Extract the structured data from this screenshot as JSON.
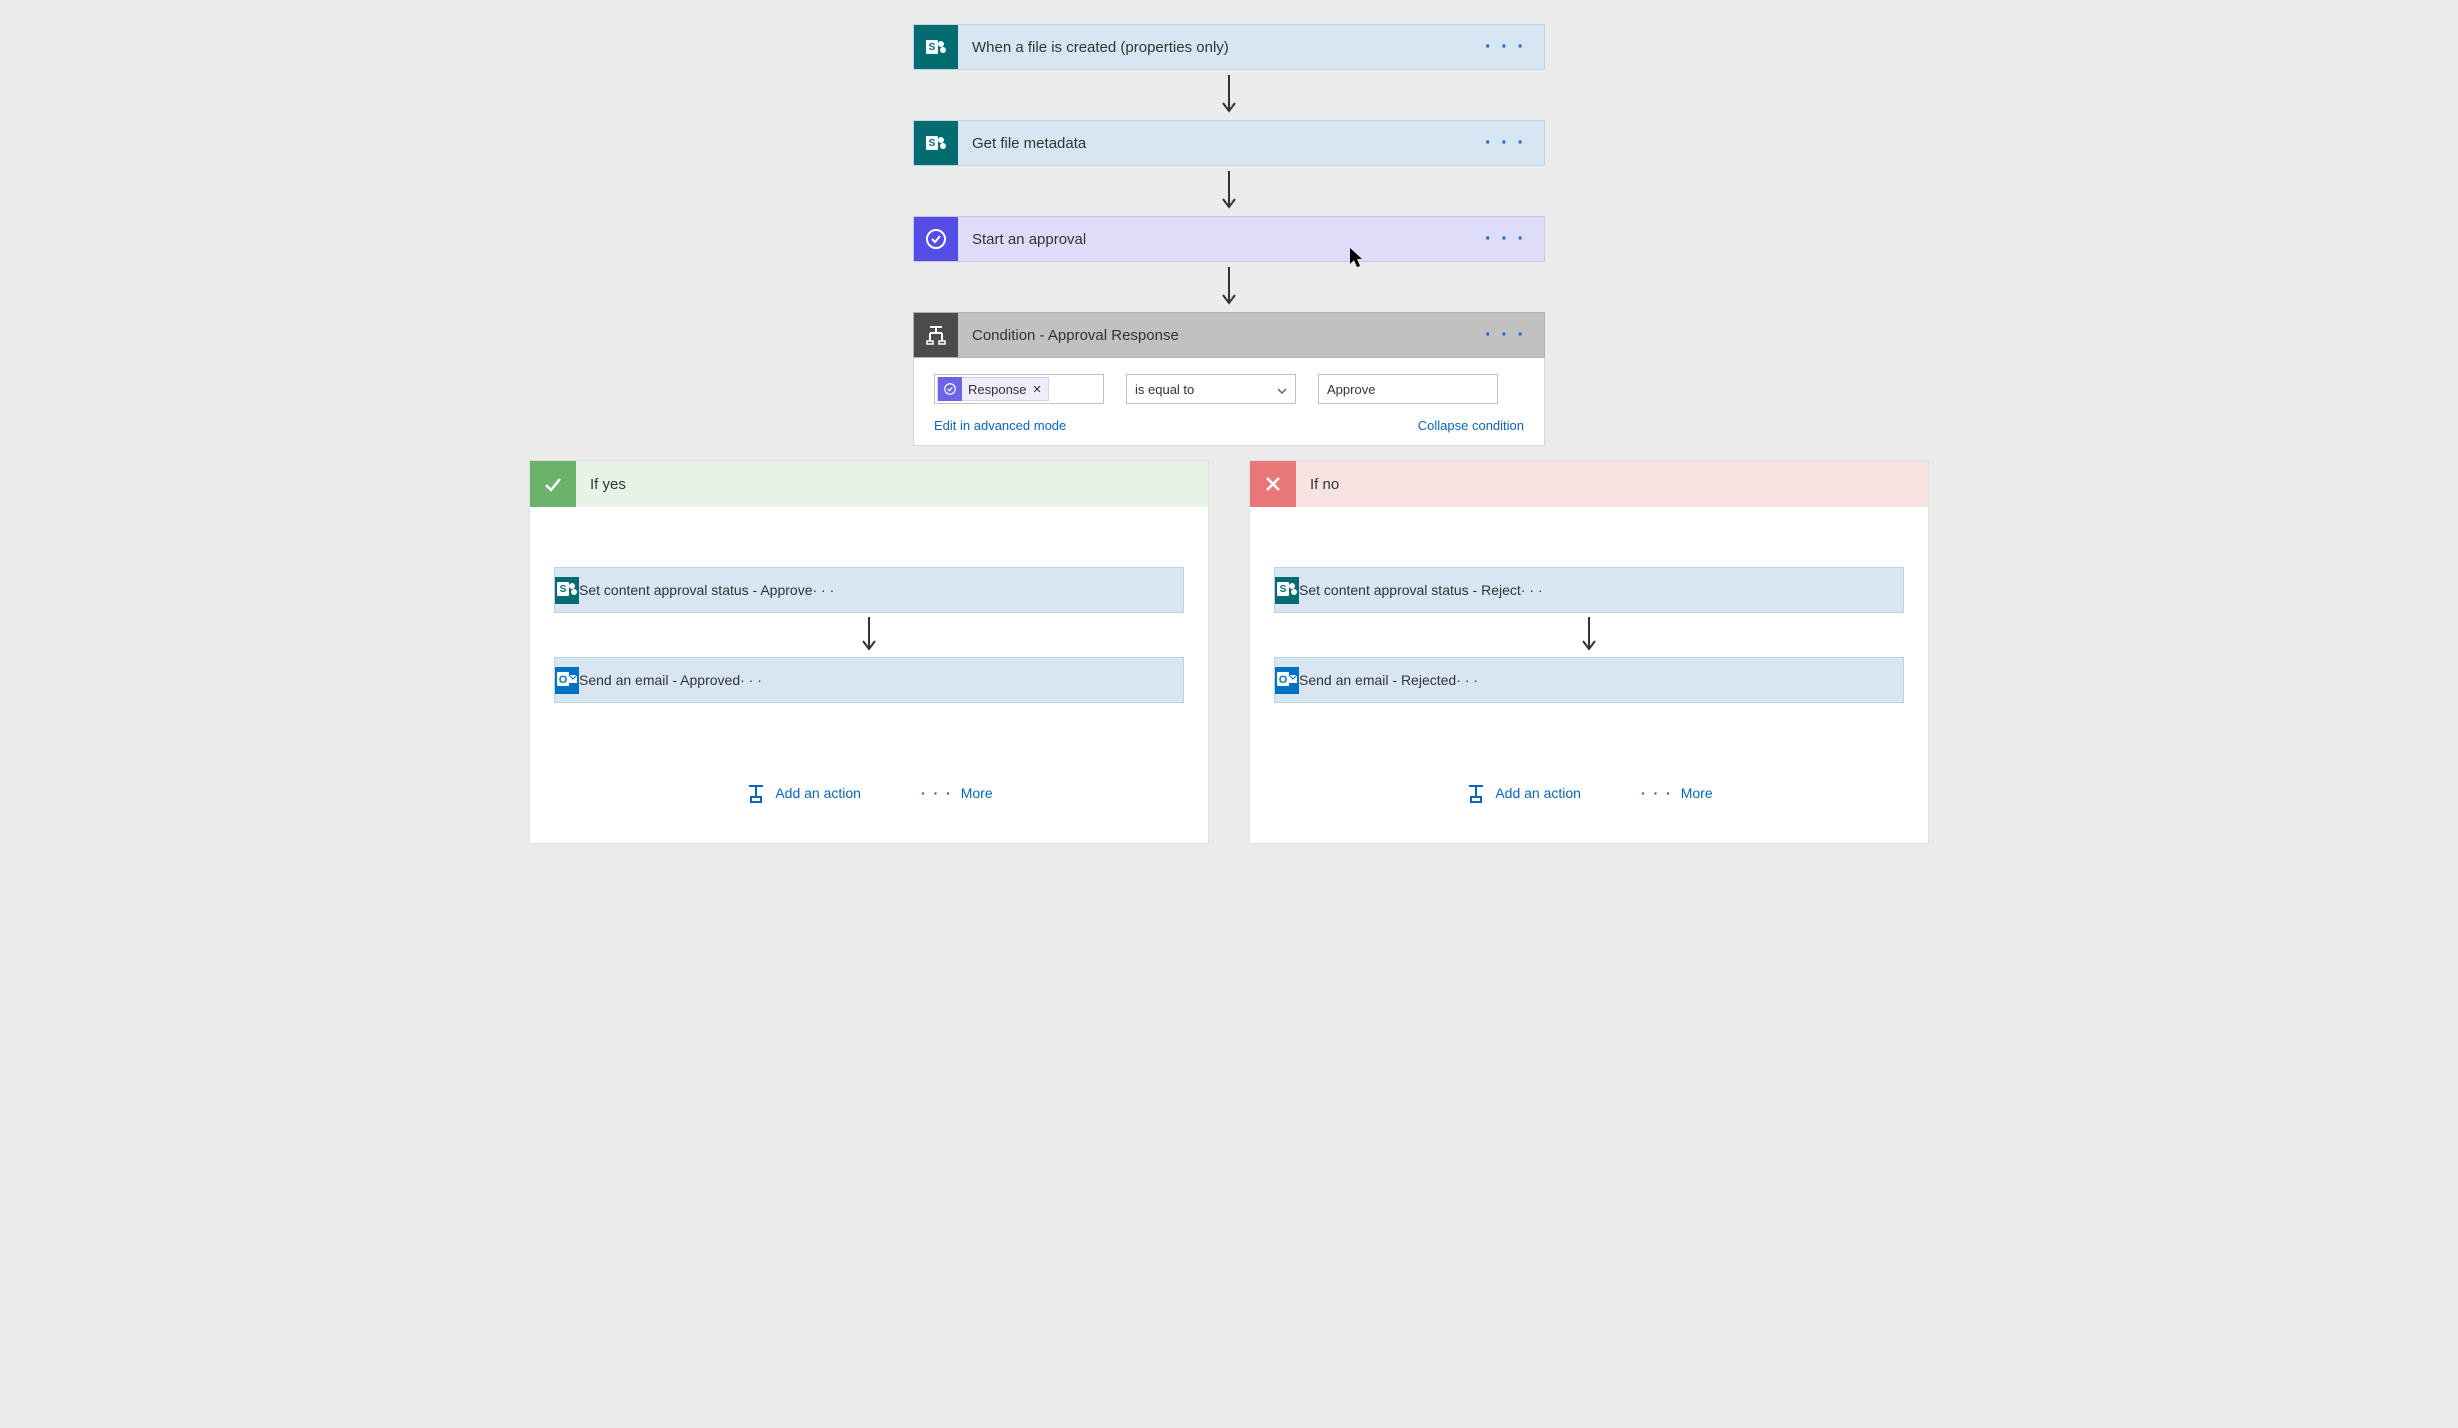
{
  "steps": {
    "trigger": "When a file is created (properties only)",
    "meta": "Get file metadata",
    "approval": "Start an approval",
    "condition_title": "Condition - Approval Response"
  },
  "condition": {
    "chip_label": "Response",
    "operator": "is equal to",
    "value": "Approve",
    "edit_link": "Edit in advanced mode",
    "collapse_link": "Collapse condition"
  },
  "branches": {
    "yes": {
      "title": "If yes",
      "step1": "Set content approval status - Approve",
      "step2": "Send an email - Approved"
    },
    "no": {
      "title": "If no",
      "step1": "Set content approval status - Reject",
      "step2": "Send an email - Rejected"
    }
  },
  "labels": {
    "add_action": "Add an action",
    "more": "More"
  }
}
